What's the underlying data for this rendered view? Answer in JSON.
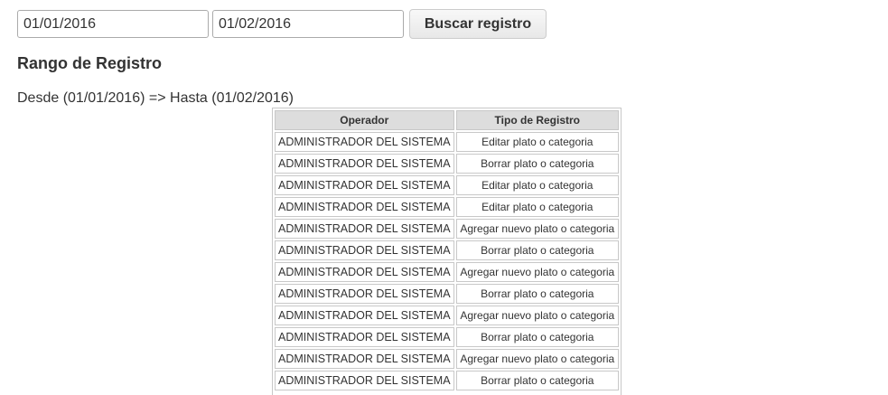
{
  "search": {
    "from_value": "01/01/2016",
    "to_value": "01/02/2016",
    "button_label": "Buscar registro"
  },
  "section": {
    "title": "Rango de Registro",
    "range_text": "Desde (01/01/2016) => Hasta (01/02/2016)"
  },
  "table": {
    "headers": [
      "Operador",
      "Tipo de Registro"
    ],
    "rows": [
      [
        "ADMINISTRADOR DEL SISTEMA",
        "Editar plato o categoria"
      ],
      [
        "ADMINISTRADOR DEL SISTEMA",
        "Borrar plato o categoria"
      ],
      [
        "ADMINISTRADOR DEL SISTEMA",
        "Editar plato o categoria"
      ],
      [
        "ADMINISTRADOR DEL SISTEMA",
        "Editar plato o categoria"
      ],
      [
        "ADMINISTRADOR DEL SISTEMA",
        "Agregar nuevo plato o categoria"
      ],
      [
        "ADMINISTRADOR DEL SISTEMA",
        "Borrar plato o categoria"
      ],
      [
        "ADMINISTRADOR DEL SISTEMA",
        "Agregar nuevo plato o categoria"
      ],
      [
        "ADMINISTRADOR DEL SISTEMA",
        "Borrar plato o categoria"
      ],
      [
        "ADMINISTRADOR DEL SISTEMA",
        "Agregar nuevo plato o categoria"
      ],
      [
        "ADMINISTRADOR DEL SISTEMA",
        "Borrar plato o categoria"
      ],
      [
        "ADMINISTRADOR DEL SISTEMA",
        "Agregar nuevo plato o categoria"
      ],
      [
        "ADMINISTRADOR DEL SISTEMA",
        "Borrar plato o categoria"
      ]
    ]
  }
}
